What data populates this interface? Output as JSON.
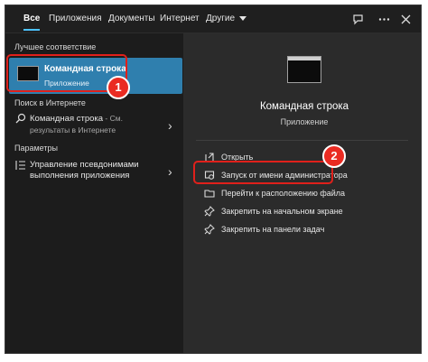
{
  "tabs": [
    "Все",
    "Приложения",
    "Документы",
    "Интернет",
    "Другие"
  ],
  "top_icons": [
    "feedback-icon",
    "more-icon",
    "close-icon"
  ],
  "left": {
    "best_match_header": "Лучшее соответствие",
    "best_match": {
      "title": "Командная строка",
      "subtitle": "Приложение"
    },
    "web_header": "Поиск в Интернете",
    "web_item": {
      "query": "Командная строка",
      "suffix": " - См.",
      "line2": "результаты в Интернете"
    },
    "settings_header": "Параметры",
    "settings_item": {
      "line1": "Управление псевдонимами",
      "line2": "выполнения приложения"
    }
  },
  "right": {
    "app_title": "Командная строка",
    "app_subtitle": "Приложение",
    "actions": [
      {
        "label": "Открыть",
        "icon": "open-icon"
      },
      {
        "label": "Запуск от имени администратора",
        "icon": "run-as-admin-icon"
      },
      {
        "label": "Перейти к расположению файла",
        "icon": "folder-icon"
      },
      {
        "label": "Закрепить на начальном экране",
        "icon": "pin-icon"
      },
      {
        "label": "Закрепить на панели задач",
        "icon": "pin-icon"
      }
    ]
  },
  "annotations": {
    "step1": "1",
    "step2": "2"
  },
  "colors": {
    "highlight": "#2f7fae",
    "annotation": "#e0201b",
    "accent": "#4cc2ff"
  }
}
